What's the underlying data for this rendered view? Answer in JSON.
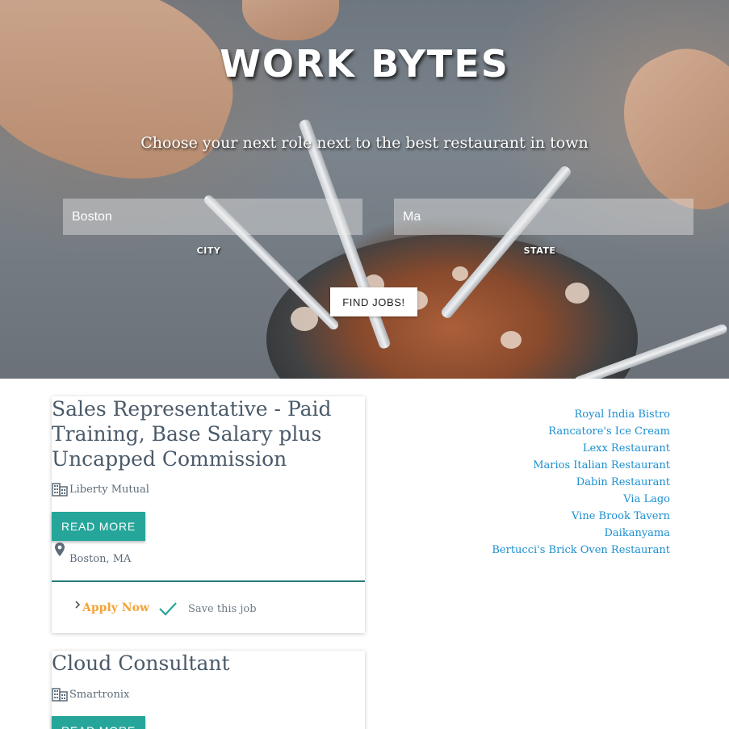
{
  "hero": {
    "title": "WORK BYTES",
    "subtitle": "Choose your next role next to the best restaurant in town",
    "city_value": "Boston",
    "state_value": "Ma",
    "city_label": "CITY",
    "state_label": "STATE",
    "find_button": "FIND JOBS!"
  },
  "jobs": [
    {
      "title": "Sales Representative - Paid Training, Base Salary plus Uncapped Commission",
      "company": "Liberty Mutual",
      "read_more": "READ MORE",
      "location": "Boston, MA",
      "apply": "Apply Now",
      "save": "Save this job"
    },
    {
      "title": "Cloud Consultant",
      "company": "Smartronix",
      "read_more": "READ MORE"
    }
  ],
  "restaurants": [
    "Royal India Bistro",
    "Rancatore's Ice Cream",
    "Lexx Restaurant",
    "Marios Italian Restaurant",
    "Dabin Restaurant",
    "Via Lago",
    "Vine Brook Tavern",
    "Daikanyama",
    "Bertucci's Brick Oven Restaurant"
  ],
  "colors": {
    "accent": "#26a69a",
    "apply": "#f2a33a",
    "link": "#1b8fd0",
    "title_text": "#4a5a69"
  },
  "icons": {
    "company": "business-building-icon",
    "location": "location-pin-icon",
    "apply": "chevron-right-icon",
    "save": "check-icon"
  }
}
